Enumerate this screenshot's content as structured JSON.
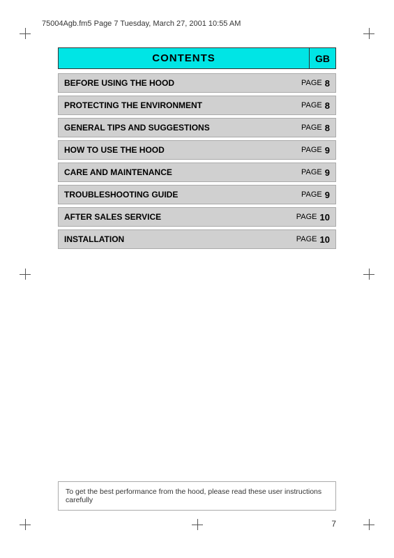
{
  "header": {
    "filename": "75004Agb.fm5  Page 7  Tuesday, March 27, 2001  10:55 AM"
  },
  "contents": {
    "title": "CONTENTS",
    "gb_label": "GB",
    "rows": [
      {
        "label": "BEFORE USING THE HOOD",
        "page_text": "PAGE",
        "page_num": "8"
      },
      {
        "label": "PROTECTING THE ENVIRONMENT",
        "page_text": "PAGE",
        "page_num": "8"
      },
      {
        "label": "GENERAL TIPS AND SUGGESTIONS",
        "page_text": "PAGE",
        "page_num": "8"
      },
      {
        "label": "HOW TO USE THE HOOD",
        "page_text": "PAGE",
        "page_num": "9"
      },
      {
        "label": "CARE AND MAINTENANCE",
        "page_text": "PAGE",
        "page_num": "9"
      },
      {
        "label": "TROUBLESHOOTING GUIDE",
        "page_text": "PAGE",
        "page_num": "9"
      },
      {
        "label": "AFTER SALES SERVICE",
        "page_text": "PAGE",
        "page_num": "10"
      },
      {
        "label": "INSTALLATION",
        "page_text": "PAGE",
        "page_num": "10"
      }
    ]
  },
  "bottom_note": "To get the best performance from the hood, please read these user instructions carefully",
  "page_number": "7"
}
